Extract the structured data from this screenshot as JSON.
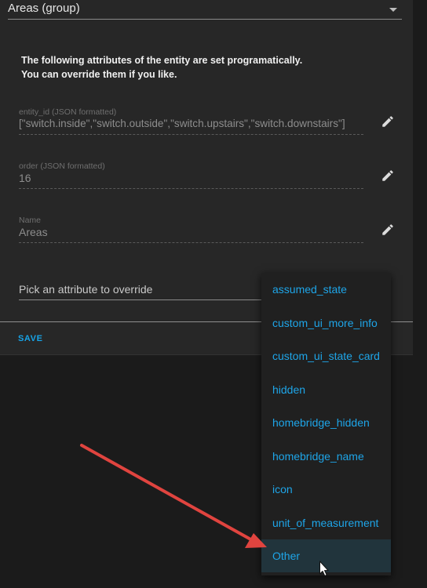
{
  "entity_select": {
    "value": "Areas (group)"
  },
  "notice": {
    "line1": "The following attributes of the entity are set programatically.",
    "line2": "You can override them if you like."
  },
  "fields": [
    {
      "label": "entity_id (JSON formatted)",
      "value": "[\"switch.inside\",\"switch.outside\",\"switch.upstairs\",\"switch.downstairs\"]"
    },
    {
      "label": "order (JSON formatted)",
      "value": "16"
    },
    {
      "label": "Name",
      "value": "Areas"
    }
  ],
  "picker": {
    "placeholder": "Pick an attribute to override"
  },
  "actions": {
    "save_label": "SAVE"
  },
  "menu": {
    "items": [
      "assumed_state",
      "custom_ui_more_info",
      "custom_ui_state_card",
      "hidden",
      "homebridge_hidden",
      "homebridge_name",
      "icon",
      "unit_of_measurement",
      "Other"
    ],
    "highlighted": "Other"
  },
  "colors": {
    "accent": "#1ea5e8",
    "annotation_arrow": "#e0443f",
    "menu_highlight": "#21343c"
  },
  "icons": {
    "edit": "pencil-icon",
    "dropdown": "caret-down-icon",
    "cursor": "mouse-pointer-icon",
    "annotation": "red-arrow"
  }
}
